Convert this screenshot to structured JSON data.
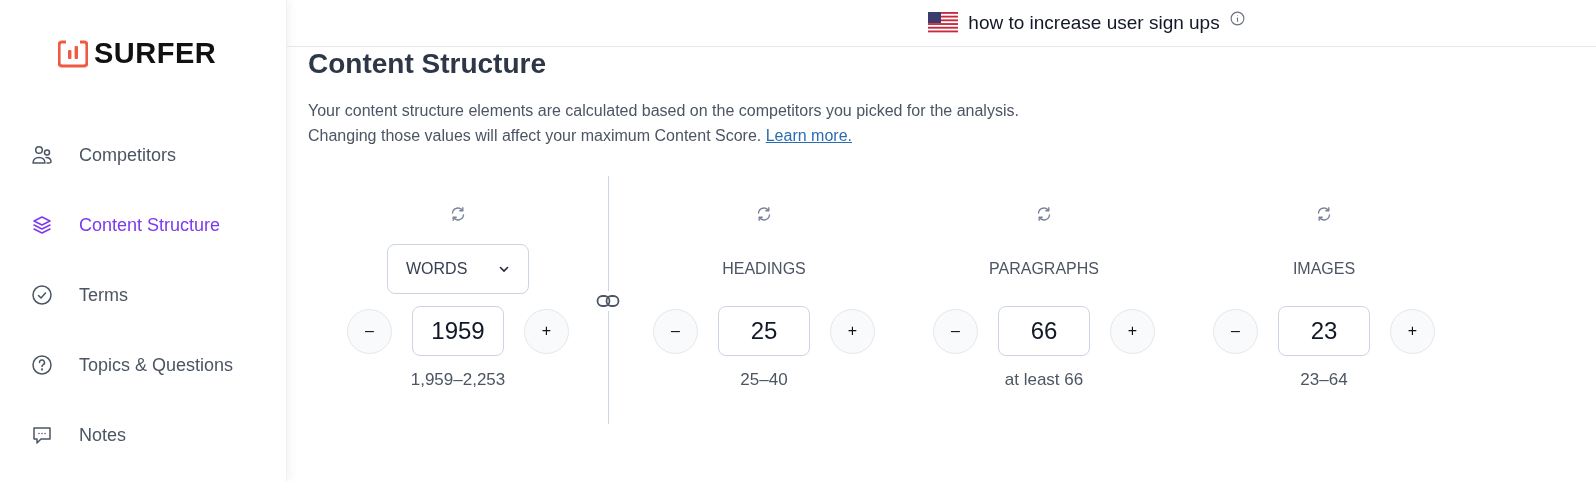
{
  "logo": {
    "text": "SURFER"
  },
  "sidebar": {
    "items": [
      {
        "label": "Competitors",
        "selected": false
      },
      {
        "label": "Content Structure",
        "selected": true
      },
      {
        "label": "Terms",
        "selected": false
      },
      {
        "label": "Topics & Questions",
        "selected": false
      },
      {
        "label": "Notes",
        "selected": false
      }
    ]
  },
  "topbar": {
    "keyword": "how to increase user sign ups"
  },
  "page": {
    "title": "Content Structure",
    "description": [
      "Your content structure elements are calculated based on the competitors you picked for the analysis.",
      "Changing those values will affect your maximum Content Score."
    ],
    "link": "Learn more."
  },
  "metrics": [
    {
      "kind": "dropdown",
      "label": "WORDS",
      "value": "1959",
      "range": "1,959–2,253",
      "minus": "–",
      "plus": "+"
    },
    {
      "kind": "label",
      "label": "HEADINGS",
      "value": "25",
      "range": "25–40",
      "minus": "–",
      "plus": "+"
    },
    {
      "kind": "label",
      "label": "PARAGRAPHS",
      "value": "66",
      "range": "at least 66",
      "minus": "–",
      "plus": "+"
    },
    {
      "kind": "label",
      "label": "IMAGES",
      "value": "23",
      "range": "23–64",
      "minus": "–",
      "plus": "+"
    }
  ]
}
